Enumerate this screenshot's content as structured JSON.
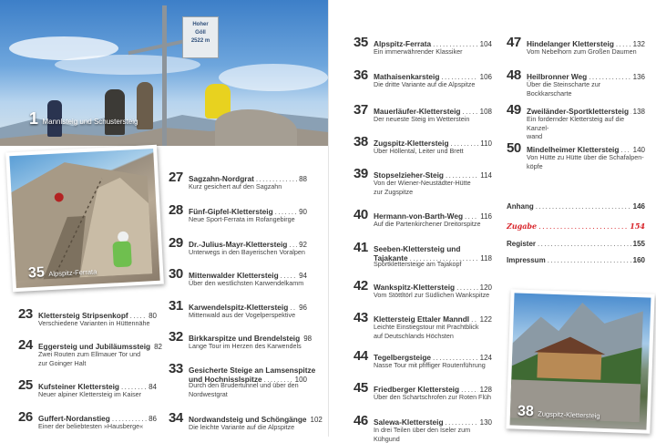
{
  "photos": {
    "summit": {
      "num": "1",
      "caption": "Mannlsteig und Schustersteig",
      "sign_lines": [
        "Hoher",
        "Göll",
        "2522 m"
      ]
    },
    "ferrata": {
      "num": "35",
      "caption": "Alpspitz-Ferrata"
    },
    "hut": {
      "num": "38",
      "caption": "Zugspitz-Klettersteig"
    }
  },
  "entries": [
    {
      "num": "23",
      "title": "Klettersteig Stripsenkopf",
      "page": "80",
      "sub": [
        "Verschiedene Varianten in Hüttennähe"
      ]
    },
    {
      "num": "24",
      "title": "Eggersteig und Jubiläumssteig",
      "page": "82",
      "sub": [
        "Zwei Routen zum Ellmauer Tor und",
        "zur Goinger Halt"
      ]
    },
    {
      "num": "25",
      "title": "Kufsteiner Klettersteig",
      "page": "84",
      "sub": [
        "Neuer alpiner Klettersteig im Kaiser"
      ]
    },
    {
      "num": "26",
      "title": "Guffert-Nordanstieg",
      "page": "86",
      "sub": [
        "Einer der beliebtesten »Hausberge«"
      ]
    },
    {
      "num": "27",
      "title": "Sagzahn-Nordgrat",
      "page": "88",
      "sub": [
        "Kurz gesichert auf den Sagzahn"
      ]
    },
    {
      "num": "28",
      "title": "Fünf-Gipfel-Klettersteig",
      "page": "90",
      "sub": [
        "Neue Sport-Ferrata im Rofangebirge"
      ]
    },
    {
      "num": "29",
      "title": "Dr.-Julius-Mayr-Klettersteig",
      "page": "92",
      "sub": [
        "Unterwegs in den Bayerischen Voralpen"
      ]
    },
    {
      "num": "30",
      "title": "Mittenwalder Klettersteig",
      "page": "94",
      "sub": [
        "Über den westlichsten Karwendelkamm"
      ]
    },
    {
      "num": "31",
      "title": "Karwendelspitz-Klettersteig",
      "page": "96",
      "sub": [
        "Mittenwald aus der Vogelperspektive"
      ]
    },
    {
      "num": "32",
      "title": "Birkkarspitze und Brendelsteig",
      "page": "98",
      "sub": [
        "Lange Tour im Herzen des Karwendels"
      ]
    },
    {
      "num": "33",
      "title": "Gesicherte Steige an Lamsenspitze",
      "title2": "und Hochnissl­spitze",
      "page": "100",
      "sub": [
        "Durch den Brudertunnel und über den",
        "Nordwestgrat"
      ]
    },
    {
      "num": "34",
      "title": "Nordwandsteig und Schöngänge",
      "page": "102",
      "sub": [
        "Die leichte Variante auf die Alpspitze"
      ]
    },
    {
      "num": "35",
      "title": "Alpspitz-Ferrata",
      "page": "104",
      "sub": [
        "Ein immerwährender Klassiker"
      ]
    },
    {
      "num": "36",
      "title": "Mathaisenkarsteig",
      "page": "106",
      "sub": [
        "Die dritte Variante auf die Alpspitze"
      ]
    },
    {
      "num": "37",
      "title": "Mauerläufer-Klettersteig",
      "page": "108",
      "sub": [
        "Der neueste Steig im Wetterstein"
      ]
    },
    {
      "num": "38",
      "title": "Zugspitz-Klettersteig",
      "page": "110",
      "sub": [
        "Über Höllental, Leiter und Brett"
      ]
    },
    {
      "num": "39",
      "title": "Stopselzieher-Steig",
      "page": "114",
      "sub": [
        "Von der Wiener-Neustädter-Hütte",
        "zur Zugspitze"
      ]
    },
    {
      "num": "40",
      "title": "Hermann-von-Barth-Weg",
      "page": "116",
      "sub": [
        "Auf die Partenkirchener Dreitorspitze"
      ]
    },
    {
      "num": "41",
      "title": "Seeben-Klettersteig und",
      "title2": "Tajakante",
      "page": "118",
      "sub": [
        "Sportklettersteige am Tajakopf"
      ]
    },
    {
      "num": "42",
      "title": "Wankspitz-Klettersteig",
      "page": "120",
      "sub": [
        "Vom Stöttltörl zur Südlichen Wankspitze"
      ]
    },
    {
      "num": "43",
      "title": "Klettersteig Ettaler Manndl",
      "page": "122",
      "sub": [
        "Leichte Einstiegstour mit Prachtblick",
        "auf Deutschlands Höchsten"
      ]
    },
    {
      "num": "44",
      "title": "Tegelbergsteige",
      "page": "124",
      "sub": [
        "Nasse Tour mit pfiffiger Routenführung"
      ]
    },
    {
      "num": "45",
      "title": "Friedberger Klettersteig",
      "page": "128",
      "sub": [
        "Über den Schartschrofen zur Roten Flüh"
      ]
    },
    {
      "num": "46",
      "title": "Salewa-Klettersteig",
      "page": "130",
      "sub": [
        "In drei Teilen über den Iseler zum Kühgund"
      ]
    },
    {
      "num": "47",
      "title": "Hindelanger Klettersteig",
      "page": "132",
      "sub": [
        "Vom Nebelhorn zum Großen Daumen"
      ]
    },
    {
      "num": "48",
      "title": "Heilbronner Weg",
      "page": "136",
      "sub": [
        "Über die Steinscharte zur Bockkarscharte"
      ]
    },
    {
      "num": "49",
      "title": "Zweiländer-Sportklettersteig",
      "page": "138",
      "sub": [
        "Ein fordernder Klettersteig auf die Kanzel-",
        "wand"
      ]
    },
    {
      "num": "50",
      "title": "Mindelheimer Klettersteig",
      "page": "140",
      "sub": [
        "Von Hütte zu Hütte über die Schafalpen-",
        "köpfe"
      ]
    }
  ],
  "appendix": [
    {
      "label": "Anhang",
      "page": "146",
      "color": "#333333"
    },
    {
      "label": "Zugabe",
      "page": "154",
      "color": "#d8242a"
    },
    {
      "label": "Register",
      "page": "155",
      "color": "#333333"
    },
    {
      "label": "Impressum",
      "page": "160",
      "color": "#333333"
    }
  ]
}
